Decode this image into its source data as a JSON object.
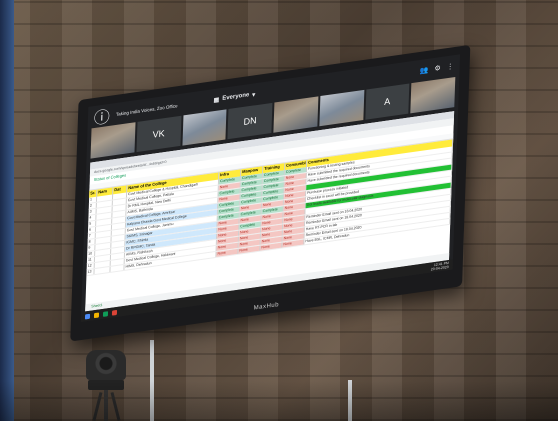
{
  "meeting": {
    "title": "Taking India Voices, Zoo Office",
    "audience": "Everyone",
    "tiles": [
      "VK",
      "DN",
      "A"
    ]
  },
  "sheet": {
    "url": "docs.google.com/spreadsheets/d/.../edit#gid=0",
    "title": "Status of Colleges",
    "headers": {
      "sno": "Sr.",
      "name": "Nam",
      "date": "Dat",
      "college": "Name of the College",
      "infra": "Infra",
      "manpower": "Manpow",
      "training": "Training",
      "consumables": "Consumbl",
      "remarks": "Comments"
    },
    "rows": [
      {
        "sno": "1",
        "college": "Govt Medical College & Hospital, Chandigarh",
        "infra": "Complete",
        "manpower": "Complete",
        "training": "Complete",
        "consumables": "Complete",
        "remarks": "Functioning & testing samples",
        "hl": false,
        "green": false
      },
      {
        "sno": "2",
        "college": "Govt Medical College, Patiala",
        "infra": "None",
        "manpower": "Complete",
        "training": "Complete",
        "consumables": "None",
        "remarks": "Have submitted the required documents",
        "hl": false,
        "green": false
      },
      {
        "sno": "3",
        "college": "Dr RML Hospital, New Delhi",
        "infra": "Complete",
        "manpower": "Complete",
        "training": "Complete",
        "consumables": "None",
        "remarks": "Have submitted the required documents",
        "hl": false,
        "green": false
      },
      {
        "sno": "4",
        "college": "AIIMS, Bathinda",
        "infra": "None",
        "manpower": "Complete",
        "training": "Complete",
        "consumables": "None",
        "remarks": "",
        "hl": false,
        "green": true
      },
      {
        "sno": "5",
        "college": "Govt Medical College, Amritsar",
        "infra": "Complete",
        "manpower": "Complete",
        "training": "Complete",
        "consumables": "None",
        "remarks": "Purchase process initiated",
        "hl": true,
        "green": false
      },
      {
        "sno": "6",
        "college": "Kalpana Chawla Govt Medical College",
        "infra": "Complete",
        "manpower": "None",
        "training": "None",
        "consumables": "None",
        "remarks": "Checklist in excel will be provided",
        "hl": true,
        "green": false
      },
      {
        "sno": "7",
        "college": "Govt Medical College, Jammu",
        "infra": "Complete",
        "manpower": "Complete",
        "training": "Complete",
        "consumables": "None",
        "remarks": "Got leads available for molecular diagnosis",
        "hl": false,
        "green": true
      },
      {
        "sno": "8",
        "college": "SKIMS, Srinagar",
        "infra": "None",
        "manpower": "None",
        "training": "None",
        "consumables": "None",
        "remarks": "",
        "hl": true,
        "green": false
      },
      {
        "sno": "9",
        "college": "IGMC, Shimla",
        "infra": "None",
        "manpower": "Complete",
        "training": "None",
        "consumables": "None",
        "remarks": "Reminder Email sent on 18.04.2020",
        "hl": true,
        "green": false
      },
      {
        "sno": "10",
        "college": "Dr RPGMC, Tanda",
        "infra": "None",
        "manpower": "None",
        "training": "None",
        "consumables": "None",
        "remarks": "Reminder Email sent on 18.04.2020",
        "hl": true,
        "green": false
      },
      {
        "sno": "11",
        "college": "AIIMS, Rishikesh",
        "infra": "None",
        "manpower": "None",
        "training": "None",
        "consumables": "None",
        "remarks": "Have RT-PCR in lab",
        "hl": false,
        "green": false
      },
      {
        "sno": "12",
        "college": "Govt Medical College, Haldwani",
        "infra": "None",
        "manpower": "None",
        "training": "None",
        "consumables": "None",
        "remarks": "Reminder Email sent on 18.04.2020",
        "hl": false,
        "green": false
      },
      {
        "sno": "13",
        "college": "HIMS, Dehradun",
        "infra": "None",
        "manpower": "None",
        "training": "None",
        "consumables": "None",
        "remarks": "Have BSL, ICMR, Dehradun",
        "hl": false,
        "green": false
      }
    ],
    "tab_label": "Sheet1"
  },
  "taskbar": {
    "time": "12:41 PM",
    "date": "20-04-2020"
  },
  "brand": "MaxHub",
  "colors": {
    "complete": "#b7e1cd",
    "none": "#f4c7c3",
    "header": "#ffeb3b",
    "highlight": "#cfe8fc",
    "green": "#22c034"
  }
}
